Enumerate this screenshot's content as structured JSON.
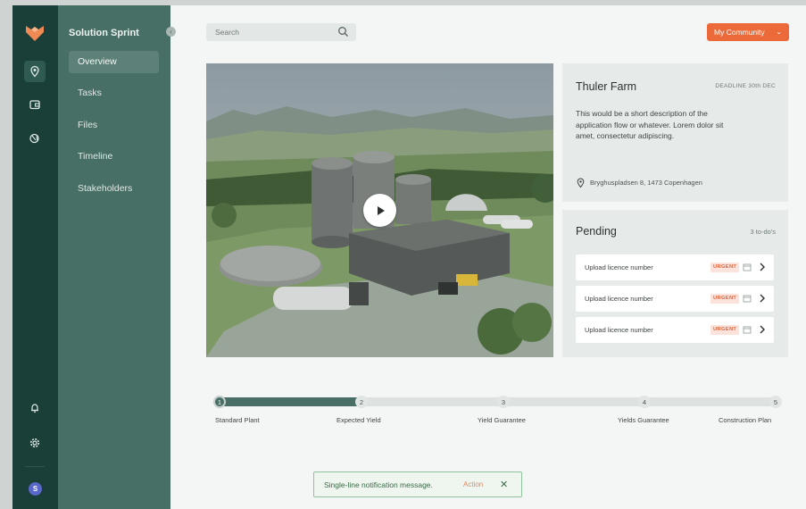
{
  "sidebar": {
    "project_title": "Solution Sprint",
    "items": [
      {
        "label": "Overview"
      },
      {
        "label": "Tasks"
      },
      {
        "label": "Files"
      },
      {
        "label": "Timeline"
      },
      {
        "label": "Stakeholders"
      }
    ],
    "rail_icons": [
      "location-icon",
      "wallet-icon",
      "globe-icon",
      "bell-icon",
      "settings-icon"
    ],
    "avatar_initial": "S"
  },
  "header": {
    "search_placeholder": "Search",
    "community_label": "My Community"
  },
  "project": {
    "name": "Thuler Farm",
    "deadline": "DEADLINE 30th DEC",
    "description": "This would be a short description of the application flow or whatever. Lorem dolor sit amet, consectetur adipiscing.",
    "address": "Bryghuspladsen 8, 1473 Copenhagen"
  },
  "pending": {
    "title": "Pending",
    "count": "3 to-do's",
    "tasks": [
      {
        "label": "Upload licence number",
        "badge": "URGENT"
      },
      {
        "label": "Upload licence number",
        "badge": "URGENT"
      },
      {
        "label": "Upload licence number",
        "badge": "URGENT"
      }
    ]
  },
  "stepper": {
    "progress": 0.25,
    "steps": [
      {
        "number": "1",
        "label": "Standard Plant"
      },
      {
        "number": "2",
        "label": "Expected Yield"
      },
      {
        "number": "3",
        "label": "Yield Guarantee"
      },
      {
        "number": "4",
        "label": "Yields Guarantee"
      },
      {
        "number": "5",
        "label": "Construction Plan"
      }
    ]
  },
  "toast": {
    "message": "Single-line notification message.",
    "action": "Action",
    "close": "✕"
  },
  "colors": {
    "rail": "#1a3e38",
    "sidenav": "#476f66",
    "accent": "#ec6a3a",
    "urgent": "#e0643b"
  }
}
